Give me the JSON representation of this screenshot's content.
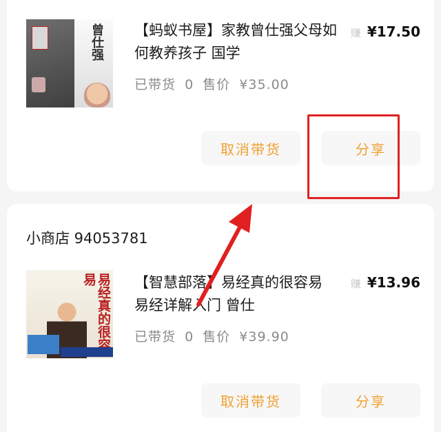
{
  "items": [
    {
      "shop_name": "",
      "title": "【蚂蚁书屋】家教曾仕强父母如何教养孩子 国学",
      "carried_label": "已带货",
      "carried_count": "0",
      "price_label": "售价",
      "price": "¥35.00",
      "earn_tag": "赚",
      "earn_amount": "¥17.50",
      "cancel_label": "取消带货",
      "share_label": "分享"
    },
    {
      "shop_name": "小商店 94053781",
      "title": "【智慧部落】易经真的很容易 易经详解入门 曾仕",
      "carried_label": "已带货",
      "carried_count": "0",
      "price_label": "售价",
      "price": "¥39.90",
      "earn_tag": "赚",
      "earn_amount": "¥13.96",
      "cancel_label": "取消带货",
      "share_label": "分享"
    }
  ],
  "annotation": {
    "highlight_color": "#e02020",
    "highlight_target": "share-button"
  },
  "colors": {
    "accent": "#f0a030",
    "button_bg": "#f7f7f7",
    "card_bg": "#ffffff",
    "page_bg": "#f5f5f5"
  }
}
